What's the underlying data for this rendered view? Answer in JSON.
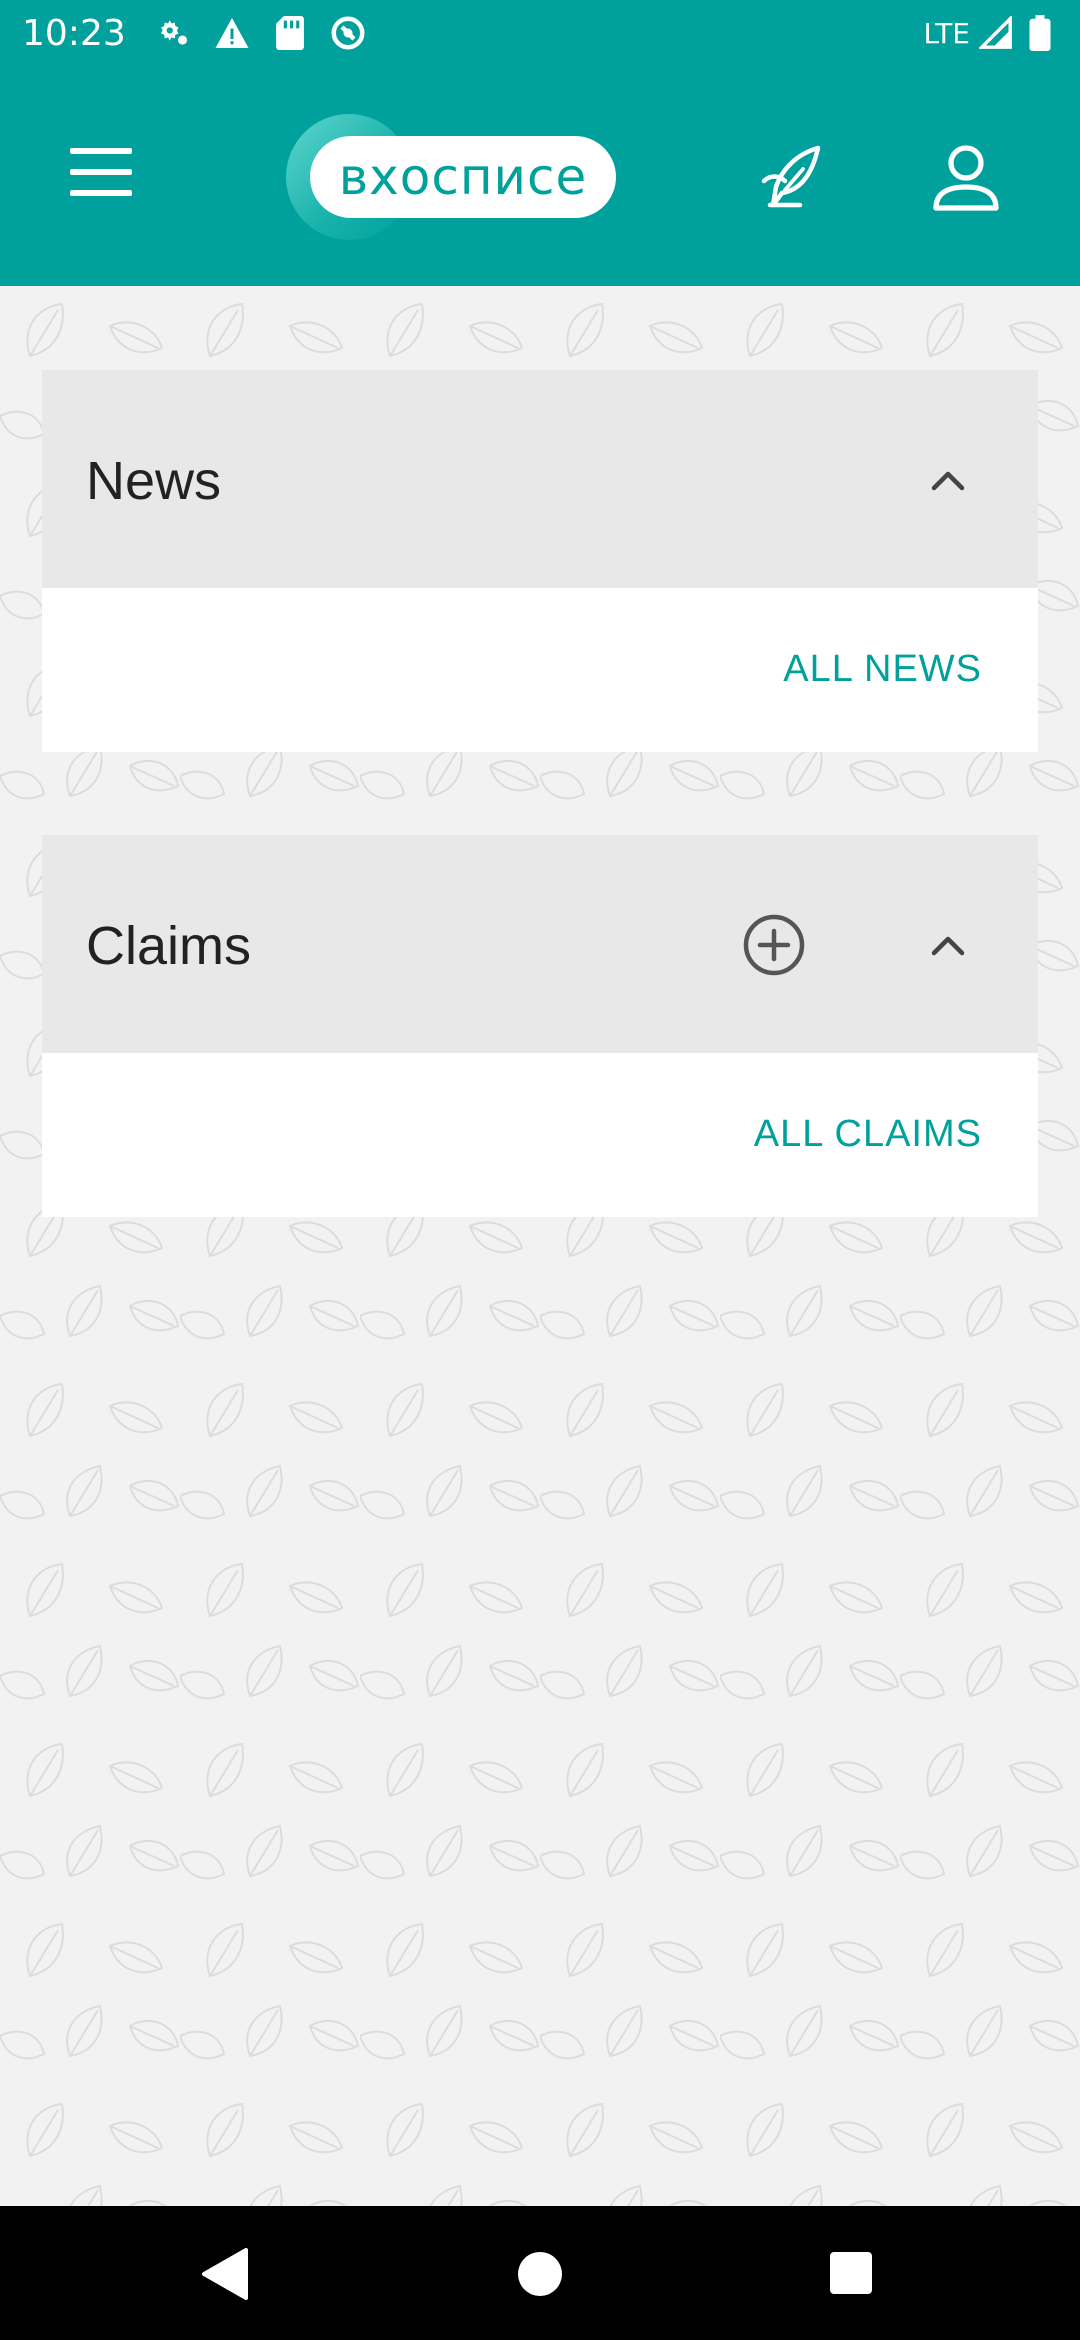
{
  "status_bar": {
    "time": "10:23",
    "network": "LTE",
    "icons": [
      "settings-icon",
      "warning-icon",
      "sd-card-icon",
      "sync-icon",
      "signal-icon",
      "battery-icon"
    ]
  },
  "app_bar": {
    "logo_text": "вхосписе",
    "icons": [
      "menu-icon",
      "quill-icon",
      "profile-icon"
    ]
  },
  "sections": {
    "news": {
      "title": "News",
      "link": "ALL NEWS"
    },
    "claims": {
      "title": "Claims",
      "link": "ALL CLAIMS"
    }
  },
  "colors": {
    "primary": "#00a19c",
    "card_header": "#e8e8e8",
    "background": "#f2f2f2"
  }
}
